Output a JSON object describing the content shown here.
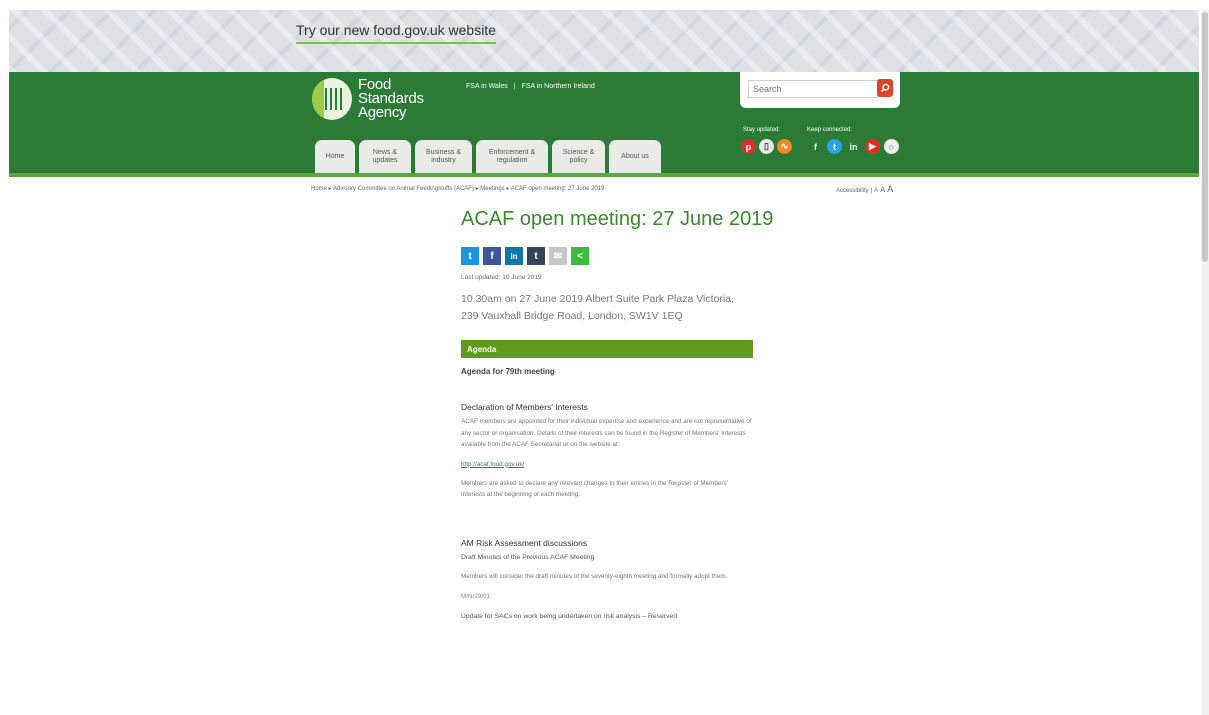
{
  "banner": {
    "new_site_link": "Try our new food.gov.uk website"
  },
  "logo": {
    "line1": "Food",
    "line2": "Standards",
    "line3": "Agency"
  },
  "top_links": {
    "wales": "FSA in Wales",
    "northern_ireland": "FSA in Northern Ireland"
  },
  "search": {
    "placeholder": "Search"
  },
  "social": {
    "stay_label": "Stay updated:",
    "keep_label": "Keep connected:",
    "stay_icons": [
      "pinterest-icon",
      "mobile-icon",
      "rss-icon"
    ],
    "keep_icons": [
      "facebook-icon",
      "twitter-icon",
      "linkedin-icon",
      "youtube-icon",
      "instagram-icon"
    ]
  },
  "nav": {
    "home": "Home",
    "news": [
      "News &",
      "updates"
    ],
    "business": [
      "Business &",
      "industry"
    ],
    "enforcement": [
      "Enforcement &",
      "regulation"
    ],
    "science": [
      "Science &",
      "policy"
    ],
    "about": "About us"
  },
  "breadcrumb": "Home ▸ Advisory Committee on Animal Feedingstuffs (ACAF) ▸ Meetings ▸ ACAF open meeting: 27 June 2019",
  "accessibility": {
    "label": "Accessibility",
    "sizes": [
      "A",
      "A",
      "A"
    ]
  },
  "page": {
    "title": "ACAF open meeting: 27 June 2019",
    "share_icons": [
      "twitter-icon",
      "facebook-icon",
      "linkedin-icon",
      "tumblr-icon",
      "email-icon",
      "share-icon"
    ],
    "last_updated": "Last updated: 10 June 2019",
    "location": "10.30am on 27 June 2019 Albert Suite Park Plaza Victoria, 239 Vauxhall Bridge Road, London, SW1V 1EQ"
  },
  "agenda": {
    "bar": "Agenda",
    "for": "Agenda for 79th meeting",
    "declaration_heading": "Declaration of Members' Interests",
    "declaration_text": "ACAF members are appointed for their individual expertise and experience and are not representative of any sector or organisation.  Details of their interests can be found in the Register of Members' Interests available from the ACAF Secretariat or on the website at:",
    "link": "http://acaf.food.gov.uk/",
    "members_text": "Members are asked to declare any relevant changes to their entries in the Register of Members' Interests at the beginning of each meeting.",
    "am_heading": "AM Risk Assessment discussions",
    "draft_minutes": "Draft Minutes of the Previous ACAF Meeting",
    "draft_text": "Members will consider the draft minutes of the seventy-eighth meeting and formally adopt them.",
    "min_ref": "MIN/19/01",
    "update": "Update for SACs on work being undertaken on risk analysis – Reserved"
  }
}
